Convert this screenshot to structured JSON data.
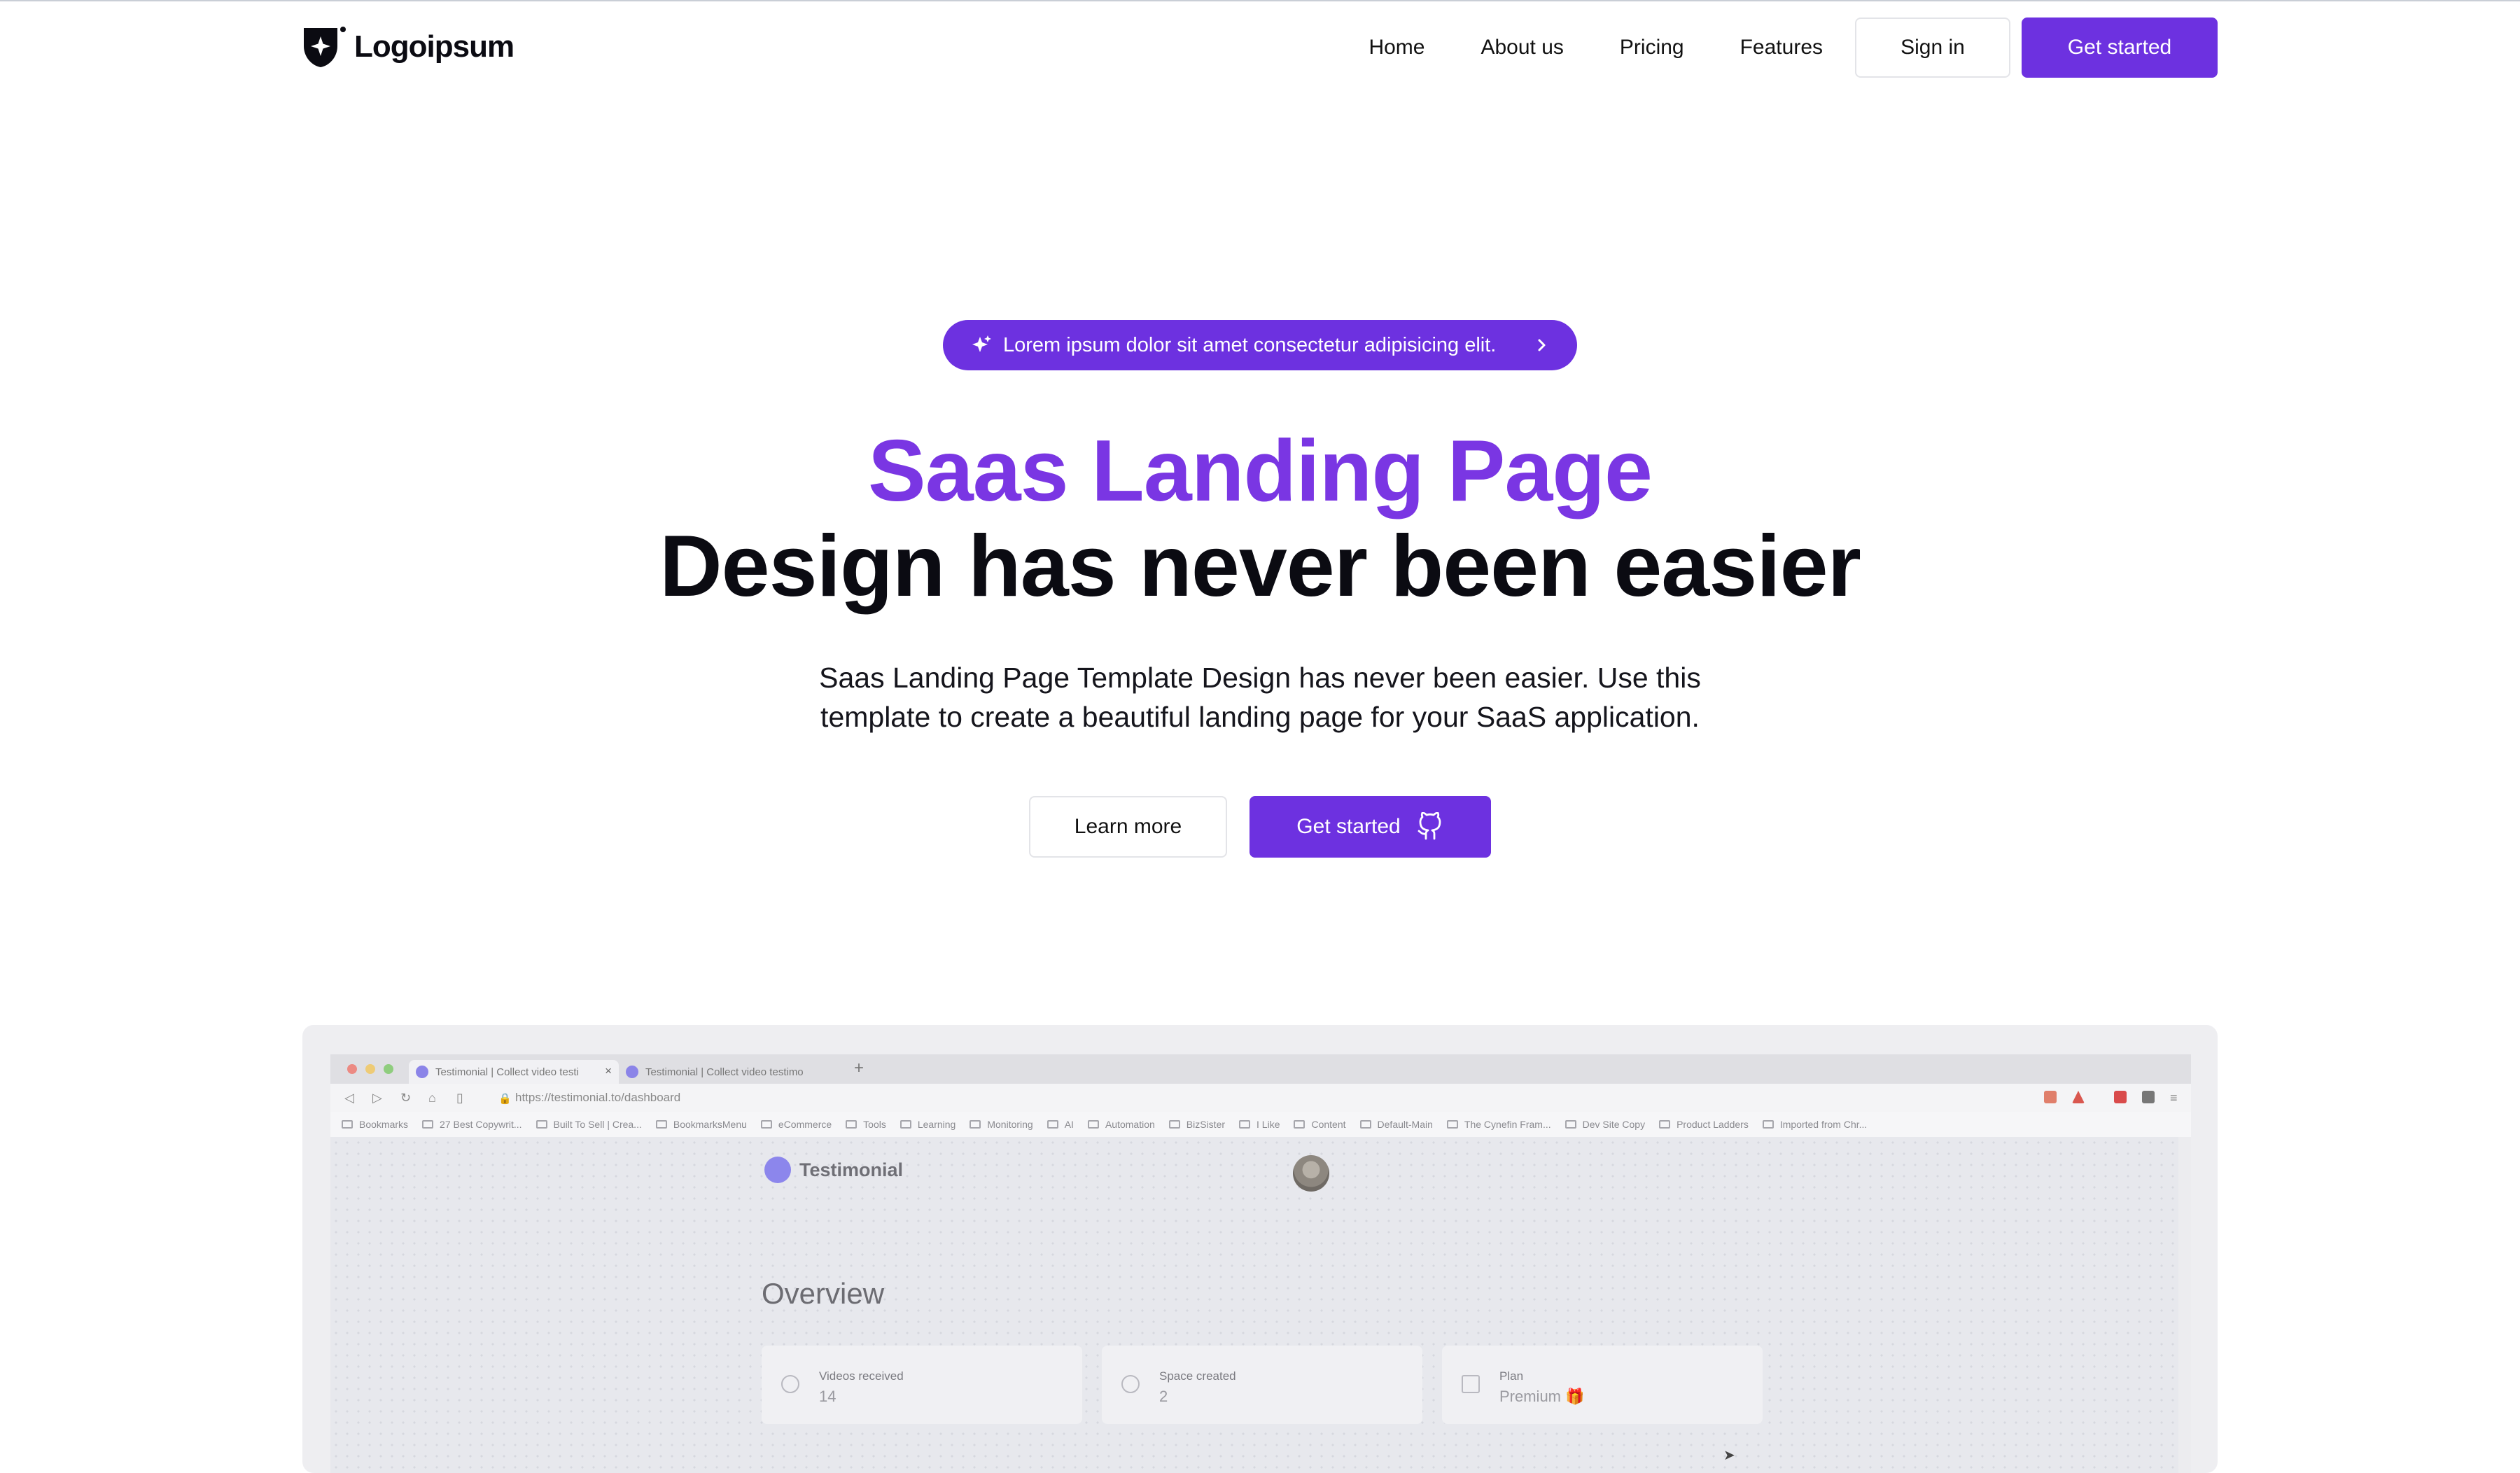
{
  "nav": {
    "logo_text": "Logoipsum",
    "links": [
      "Home",
      "About us",
      "Pricing",
      "Features"
    ],
    "sign_in": "Sign in",
    "get_started": "Get started"
  },
  "hero": {
    "pill_text": "Lorem ipsum dolor sit amet consectetur adipisicing elit.",
    "title_line1": "Saas Landing Page",
    "title_line2": "Design has never been easier",
    "subtitle_line1": "Saas Landing Page Template Design has never been easier. Use this",
    "subtitle_line2": "template to create a beautiful landing page for your SaaS application.",
    "learn_more": "Learn more",
    "get_started": "Get started"
  },
  "preview": {
    "tabs": [
      "Testimonial | Collect video testi",
      "Testimonial | Collect video testimo"
    ],
    "url": "https://testimonial.to/dashboard",
    "bookmarks": [
      "Bookmarks",
      "27 Best Copywrit...",
      "Built To Sell | Crea...",
      "BookmarksMenu",
      "eCommerce",
      "Tools",
      "Learning",
      "Monitoring",
      "AI",
      "Automation",
      "BizSister",
      "I Like",
      "Content",
      "Default-Main",
      "The Cynefin Fram...",
      "Dev Site Copy",
      "Product Ladders",
      "Imported from Chr..."
    ],
    "app_name": "Testimonial",
    "overview": "Overview",
    "cards": [
      {
        "label": "Videos received",
        "value": "14"
      },
      {
        "label": "Space created",
        "value": "2"
      },
      {
        "label": "Plan",
        "value": "Premium 🎁"
      }
    ]
  },
  "colors": {
    "accent": "#6d31e0",
    "title_purple": "#7a36e3",
    "text_dark": "#0b0b12"
  }
}
